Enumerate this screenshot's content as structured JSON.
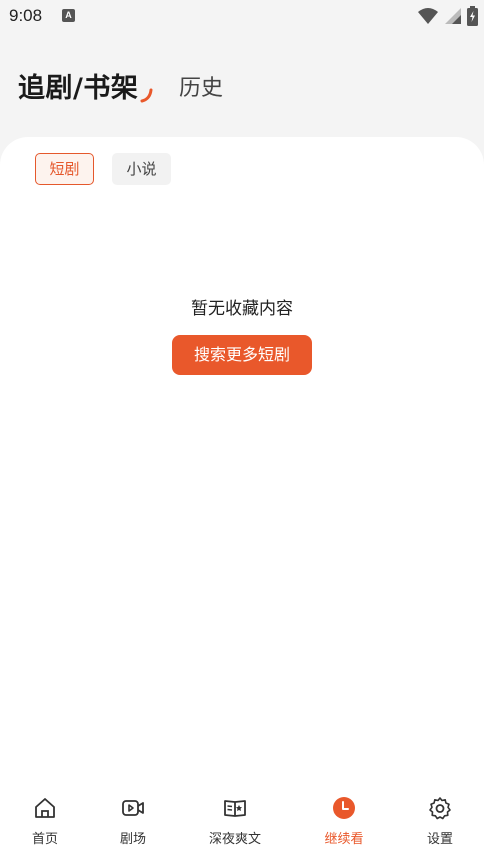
{
  "status_bar": {
    "time": "9:08",
    "notification_icon": "A"
  },
  "header": {
    "tab_main": "追剧/书架",
    "tab_history": "历史"
  },
  "filters": {
    "chips": [
      {
        "label": "短剧",
        "active": true
      },
      {
        "label": "小说",
        "active": false
      }
    ]
  },
  "empty_state": {
    "message": "暂无收藏内容",
    "button_label": "搜索更多短剧"
  },
  "bottom_nav": {
    "items": [
      {
        "label": "首页",
        "icon": "home-icon"
      },
      {
        "label": "剧场",
        "icon": "video-icon"
      },
      {
        "label": "深夜爽文",
        "icon": "book-icon"
      },
      {
        "label": "继续看",
        "icon": "clock-icon",
        "active": true
      },
      {
        "label": "设置",
        "icon": "gear-icon"
      }
    ]
  },
  "colors": {
    "accent": "#e9582b",
    "background": "#f4f4f4",
    "card": "#ffffff"
  }
}
